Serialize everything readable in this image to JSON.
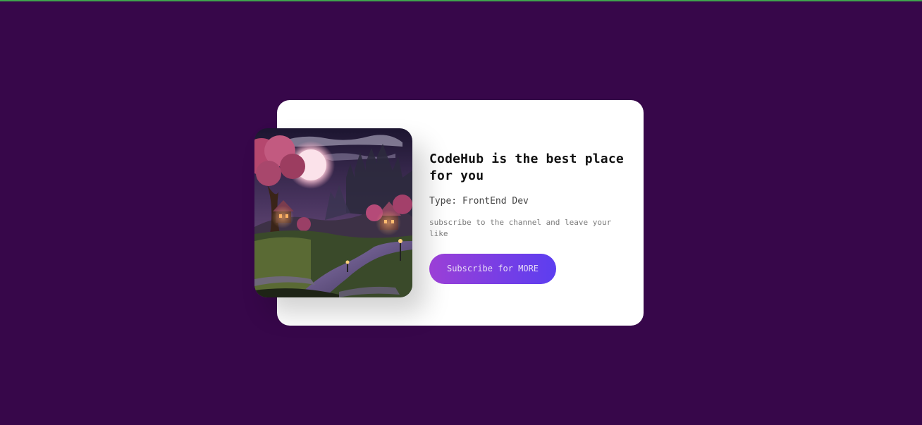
{
  "card": {
    "title": "CodeHub is the best place for you",
    "type_line": "Type: FrontEnd Dev",
    "description": "subscribe to the channel and leave your like",
    "button_label": "Subscribe for MORE",
    "image_icon": "fantasy-village-night-illustration"
  },
  "colors": {
    "background": "#37074a",
    "card": "#ffffff",
    "button_gradient_start": "#9b3fd6",
    "button_gradient_end": "#5c3ef0"
  }
}
